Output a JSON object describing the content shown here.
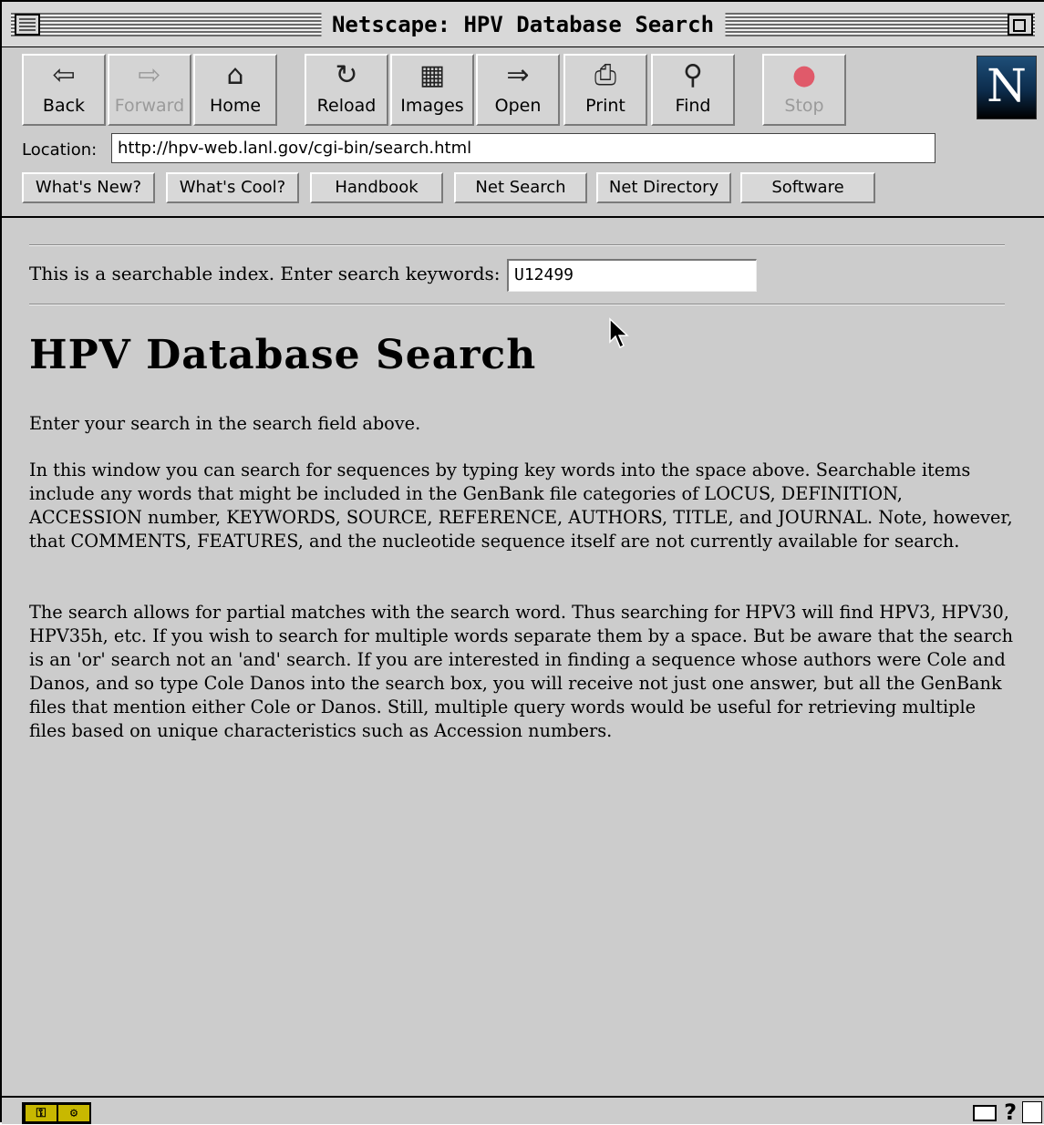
{
  "window": {
    "title": "Netscape: HPV Database Search"
  },
  "toolbar": {
    "buttons": [
      {
        "label": "Back",
        "icon": "back-arrow-icon",
        "glyph": "⇦",
        "enabled": true
      },
      {
        "label": "Forward",
        "icon": "forward-arrow-icon",
        "glyph": "⇨",
        "enabled": false
      },
      {
        "label": "Home",
        "icon": "home-icon",
        "glyph": "⌂",
        "enabled": true
      },
      {
        "label": "Reload",
        "icon": "reload-icon",
        "glyph": "↻",
        "enabled": true
      },
      {
        "label": "Images",
        "icon": "images-icon",
        "glyph": "▦",
        "enabled": true
      },
      {
        "label": "Open",
        "icon": "open-icon",
        "glyph": "⇒",
        "enabled": true
      },
      {
        "label": "Print",
        "icon": "print-icon",
        "glyph": "⎙",
        "enabled": true
      },
      {
        "label": "Find",
        "icon": "find-binoculars-icon",
        "glyph": "⚲",
        "enabled": true
      },
      {
        "label": "Stop",
        "icon": "stop-icon",
        "glyph": "●",
        "enabled": false
      }
    ]
  },
  "location": {
    "label": "Location:",
    "url": "http://hpv-web.lanl.gov/cgi-bin/search.html"
  },
  "directory_buttons": [
    "What's New?",
    "What's Cool?",
    "Handbook",
    "Net Search",
    "Net Directory",
    "Software"
  ],
  "content": {
    "index_prompt": "This is a searchable index. Enter search keywords:",
    "search_value": "U12499",
    "title": "HPV Database Search",
    "paragraphs": [
      "Enter your search in the search field above.",
      "In this window you can search for sequences by typing key words into the space above. Searchable items include any words that might be included in the GenBank file categories of LOCUS, DEFINITION, ACCESSION number, KEYWORDS, SOURCE, REFERENCE, AUTHORS, TITLE, and JOURNAL. Note, however, that COMMENTS, FEATURES, and the nucleotide sequence itself are not currently available for search.",
      "The search allows for partial matches with the search word. Thus searching for HPV3 will find HPV3, HPV30, HPV35h, etc. If you wish to search for multiple words separate them by a space. But be aware that the search is an 'or' search not an 'and' search. If you are interested in finding a sequence whose authors were Cole and Danos, and so type Cole Danos into the search box, you will receive not just one answer, but all the GenBank files that mention either Cole or Danos. Still, multiple query words would be useful for retrieving multiple files based on unique characteristics such as Accession numbers."
    ]
  },
  "colors": {
    "chrome": "#cccccc",
    "stop_red": "#e05a6a",
    "logo_blue": "#1e4e78"
  }
}
